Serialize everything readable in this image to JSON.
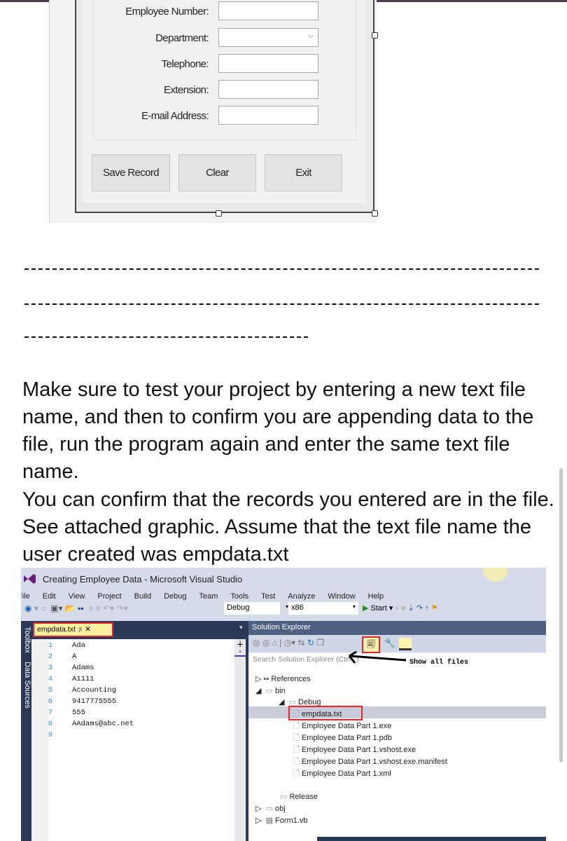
{
  "form": {
    "fields": [
      {
        "label": "Employee Number:",
        "type": "text"
      },
      {
        "label": "Department:",
        "type": "combo"
      },
      {
        "label": "Telephone:",
        "type": "text"
      },
      {
        "label": "Extension:",
        "type": "text"
      },
      {
        "label": "E-mail Address:",
        "type": "text"
      }
    ],
    "buttons": {
      "save": "Save Record",
      "clear": "Clear",
      "exit": "Exit"
    }
  },
  "instructions": {
    "p1": "Make sure to test your project by entering a new text file name, and then to confirm you are appending data to the file, run the program again and enter the same text file name.",
    "p2": "You can confirm that the records you entered are in the file. See attached graphic. Assume that the text file name the user created was empdata.txt"
  },
  "vs": {
    "title": "Creating Employee Data - Microsoft Visual Studio",
    "menu": [
      "File",
      "Edit",
      "View",
      "Project",
      "Build",
      "Debug",
      "Team",
      "Tools",
      "Test",
      "Analyze",
      "Window",
      "Help"
    ],
    "config": "Debug",
    "platform": "x86",
    "start": "Start",
    "side_tabs": [
      "Toolbox",
      "Data Sources"
    ],
    "editor_tab": "empdata.txt",
    "lines": [
      "Ada",
      "A",
      "Adams",
      "A1111",
      "Accounting",
      "9417775555",
      "555",
      "AAdams@abc.net",
      ""
    ],
    "solution_explorer": {
      "title": "Solution Explorer",
      "search_placeholder": "Search Solution Explorer (Ctrl+;)",
      "annotation": "Show all files",
      "tree": {
        "references": "References",
        "bin": "bin",
        "debug": "Debug",
        "debug_files": [
          "empdata.txt",
          "Employee Data Part 1.exe",
          "Employee Data Part 1.pdb",
          "Employee Data Part 1.vshost.exe",
          "Employee Data Part 1.vshost.exe.manifest",
          "Employee Data Part 1.xml"
        ],
        "release": "Release",
        "obj": "obj",
        "form": "Form1.vb"
      }
    },
    "highlight_color": "#e3242b"
  }
}
